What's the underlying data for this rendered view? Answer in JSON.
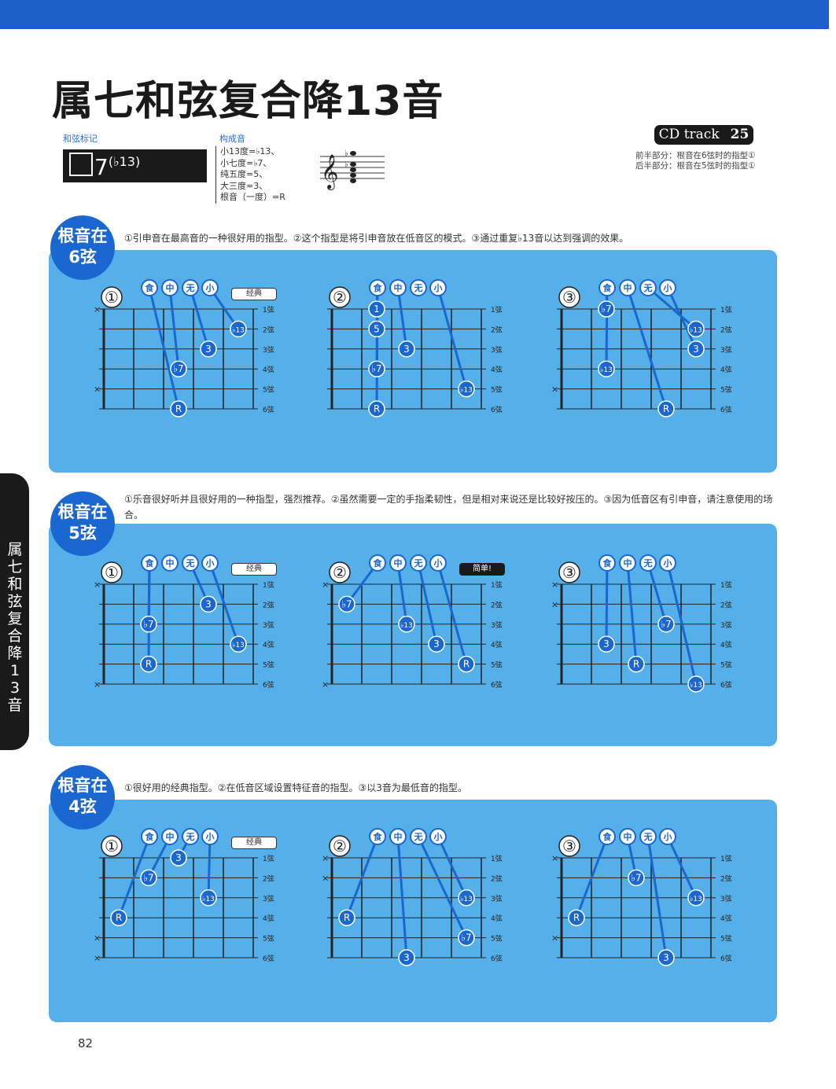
{
  "page": {
    "title": "属七和弦复合降13音",
    "page_number": "82",
    "side_tab": "属七和弦复合降13音"
  },
  "header": {
    "chord_symbol_label": "和弦标记",
    "chord_symbol": "7",
    "chord_symbol_sup": "(♭13)",
    "tones_label": "构成音",
    "tones": [
      "小13度=♭13、",
      "小七度=♭7、",
      "纯五度=5、",
      "大三度=3、",
      "根音（一度）=R"
    ],
    "cd_label": "CD track",
    "cd_track": "25",
    "cd_notes": [
      "前半部分：根音在6弦时的指型①",
      "后半部分：根音在5弦时的指型①"
    ]
  },
  "fingers": [
    "食",
    "中",
    "无",
    "小"
  ],
  "sections": [
    {
      "badge_line1": "根音在",
      "badge_line2": "6弦",
      "description": "①引申音在最高音的一种很好用的指型。②这个指型是将引申音放在低音区的模式。③通过重复♭13音以达到强调的效果。",
      "diagrams": [
        {
          "number": "①",
          "tag": "经典",
          "tag_style": "light",
          "string_labels": [
            "1弦",
            "2弦",
            "3弦",
            "4弦",
            "5弦",
            "6弦"
          ],
          "mutes": [
            1,
            5
          ],
          "dots": [
            {
              "t": "♭13",
              "s": 2,
              "fr": 4,
              "f": 4
            },
            {
              "t": "3",
              "s": 3,
              "fr": 3,
              "f": 3
            },
            {
              "t": "♭7",
              "s": 4,
              "fr": 2,
              "f": 2
            },
            {
              "t": "R",
              "s": 6,
              "fr": 2,
              "f": 1
            }
          ]
        },
        {
          "number": "②",
          "tag": "",
          "tag_style": "",
          "string_labels": [
            "1弦",
            "2弦",
            "3弦",
            "4弦",
            "5弦",
            "6弦"
          ],
          "mutes": [],
          "dots": [
            {
              "t": "1",
              "s": 1,
              "fr": 1,
              "f": 1
            },
            {
              "t": "5",
              "s": 2,
              "fr": 1,
              "f": 1
            },
            {
              "t": "3",
              "s": 3,
              "fr": 2,
              "f": 2
            },
            {
              "t": "♭7",
              "s": 4,
              "fr": 1,
              "f": 1
            },
            {
              "t": "♭13",
              "s": 5,
              "fr": 4,
              "f": 4
            },
            {
              "t": "R",
              "s": 6,
              "fr": 1,
              "f": 1
            }
          ]
        },
        {
          "number": "③",
          "tag": "",
          "tag_style": "",
          "string_labels": [
            "1弦",
            "2弦",
            "3弦",
            "4弦",
            "5弦",
            "6弦"
          ],
          "mutes": [
            5
          ],
          "dots": [
            {
              "t": "♭13",
              "s": 2,
              "fr": 4,
              "f": 3
            },
            {
              "t": "3",
              "s": 3,
              "fr": 4,
              "f": 4
            },
            {
              "t": "♭7",
              "s": 1,
              "fr": 1,
              "f": 1
            },
            {
              "t": "♭13",
              "s": 4,
              "fr": 1,
              "f": 1
            },
            {
              "t": "R",
              "s": 6,
              "fr": 3,
              "f": 2
            }
          ]
        }
      ]
    },
    {
      "badge_line1": "根音在",
      "badge_line2": "5弦",
      "description": "①乐音很好听并且很好用的一种指型，强烈推荐。②虽然需要一定的手指柔韧性，但是相对来说还是比较好按压的。③因为低音区有引申音，请注意使用的场合。",
      "diagrams": [
        {
          "number": "①",
          "tag": "经典",
          "tag_style": "light",
          "string_labels": [
            "1弦",
            "2弦",
            "3弦",
            "4弦",
            "5弦",
            "6弦"
          ],
          "mutes": [
            1,
            6
          ],
          "dots": [
            {
              "t": "3",
              "s": 2,
              "fr": 3,
              "f": 3
            },
            {
              "t": "♭7",
              "s": 3,
              "fr": 1,
              "f": 1
            },
            {
              "t": "♭13",
              "s": 4,
              "fr": 4,
              "f": 4
            },
            {
              "t": "R",
              "s": 5,
              "fr": 1,
              "f": 1
            }
          ]
        },
        {
          "number": "②",
          "tag": "简单!",
          "tag_style": "dark",
          "string_labels": [
            "1弦",
            "2弦",
            "3弦",
            "4弦",
            "5弦",
            "6弦"
          ],
          "mutes": [
            1,
            6
          ],
          "dots": [
            {
              "t": "♭7",
              "s": 2,
              "fr": 0,
              "f": 1
            },
            {
              "t": "♭13",
              "s": 3,
              "fr": 2,
              "f": 2
            },
            {
              "t": "3",
              "s": 4,
              "fr": 3,
              "f": 3
            },
            {
              "t": "R",
              "s": 5,
              "fr": 4,
              "f": 4
            }
          ]
        },
        {
          "number": "③",
          "tag": "",
          "tag_style": "",
          "string_labels": [
            "1弦",
            "2弦",
            "3弦",
            "4弦",
            "5弦",
            "6弦"
          ],
          "mutes": [
            1,
            2
          ],
          "dots": [
            {
              "t": "♭7",
              "s": 3,
              "fr": 3,
              "f": 3
            },
            {
              "t": "3",
              "s": 4,
              "fr": 1,
              "f": 1
            },
            {
              "t": "R",
              "s": 5,
              "fr": 2,
              "f": 2
            },
            {
              "t": "♭13",
              "s": 6,
              "fr": 4,
              "f": 4
            }
          ]
        }
      ]
    },
    {
      "badge_line1": "根音在",
      "badge_line2": "4弦",
      "description": "①很好用的经典指型。②在低音区域设置特征音的指型。③以3音为最低音的指型。",
      "diagrams": [
        {
          "number": "①",
          "tag": "经典",
          "tag_style": "light",
          "string_labels": [
            "1弦",
            "2弦",
            "3弦",
            "4弦",
            "5弦",
            "6弦"
          ],
          "mutes": [
            5,
            6
          ],
          "dots": [
            {
              "t": "3",
              "s": 1,
              "fr": 2,
              "f": 3
            },
            {
              "t": "♭7",
              "s": 2,
              "fr": 1,
              "f": 2
            },
            {
              "t": "♭13",
              "s": 3,
              "fr": 3,
              "f": 4
            },
            {
              "t": "R",
              "s": 4,
              "fr": 0,
              "f": 1
            }
          ]
        },
        {
          "number": "②",
          "tag": "",
          "tag_style": "",
          "string_labels": [
            "1弦",
            "2弦",
            "3弦",
            "4弦",
            "5弦",
            "6弦"
          ],
          "mutes": [
            1,
            2
          ],
          "dots": [
            {
              "t": "♭13",
              "s": 3,
              "fr": 4,
              "f": 4
            },
            {
              "t": "R",
              "s": 4,
              "fr": 0,
              "f": 1
            },
            {
              "t": "♭7",
              "s": 5,
              "fr": 4,
              "f": 3
            },
            {
              "t": "3",
              "s": 6,
              "fr": 2,
              "f": 2
            }
          ]
        },
        {
          "number": "③",
          "tag": "",
          "tag_style": "",
          "string_labels": [
            "1弦",
            "2弦",
            "3弦",
            "4弦",
            "5弦",
            "6弦"
          ],
          "mutes": [
            1,
            5
          ],
          "dots": [
            {
              "t": "♭7",
              "s": 2,
              "fr": 2,
              "f": 2
            },
            {
              "t": "♭13",
              "s": 3,
              "fr": 4,
              "f": 4
            },
            {
              "t": "R",
              "s": 4,
              "fr": 0,
              "f": 1
            },
            {
              "t": "3",
              "s": 6,
              "fr": 3,
              "f": 3
            }
          ]
        }
      ]
    }
  ],
  "colors": {
    "accent": "#1b67d1",
    "panel": "#55b0ea",
    "ink": "#1a1a1a"
  }
}
